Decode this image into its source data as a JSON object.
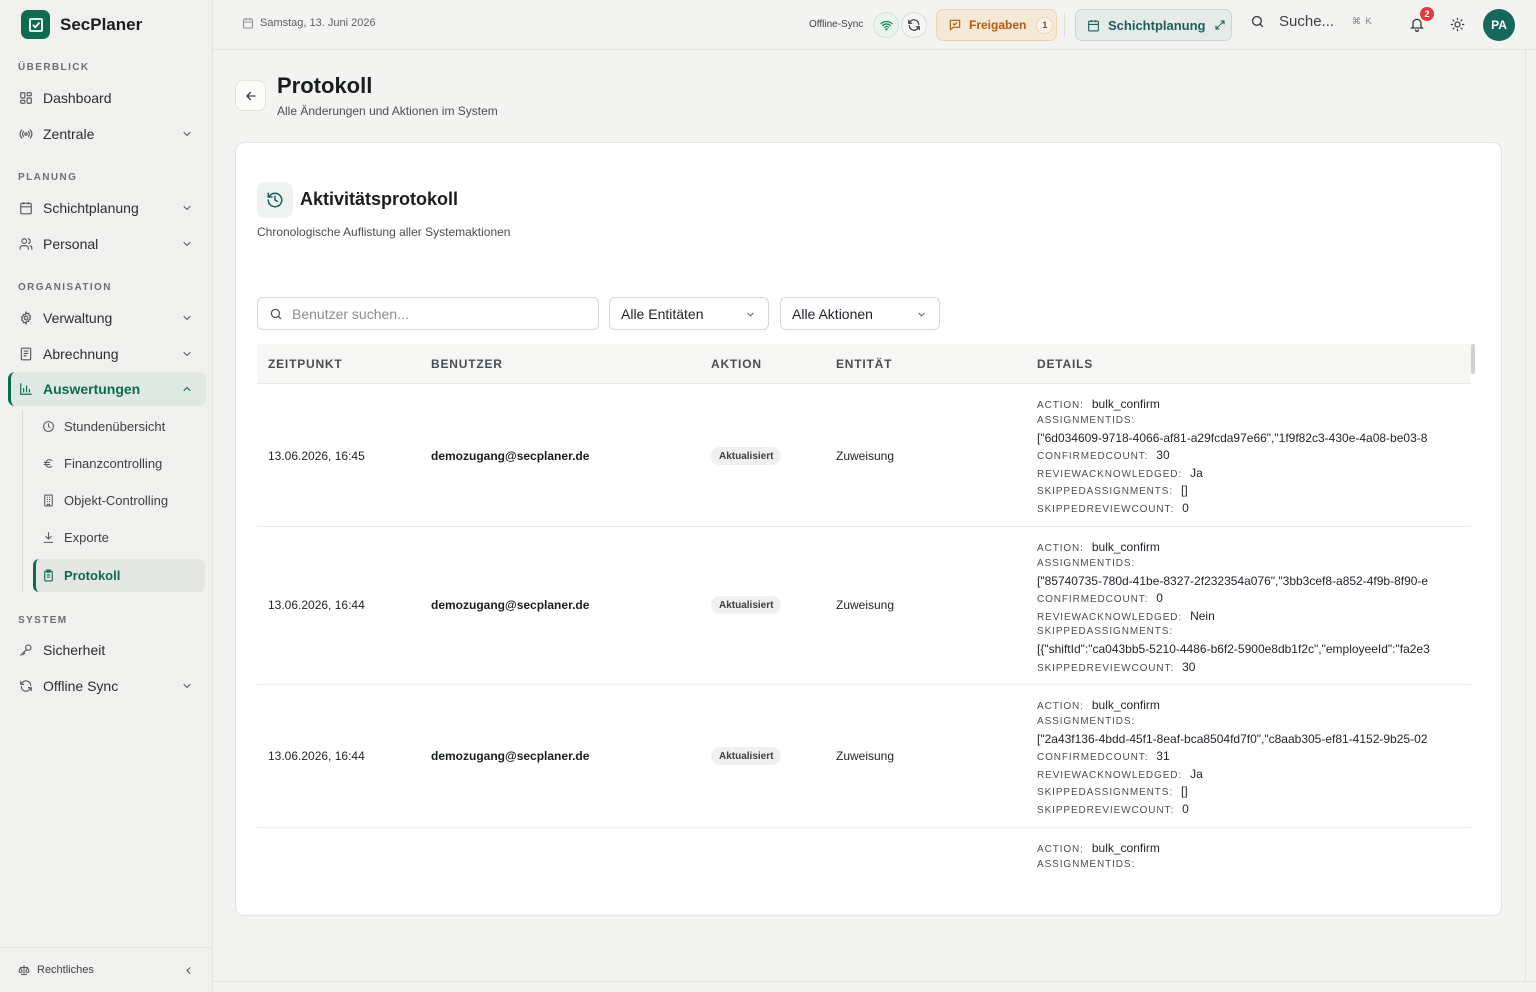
{
  "app": {
    "name": "SecPlaner"
  },
  "sidebar": {
    "sections": {
      "overview": "ÜBERBLICK",
      "planning": "PLANUNG",
      "organisation": "ORGANISATION",
      "system": "SYSTEM"
    },
    "items": {
      "dashboard": "Dashboard",
      "zentrale": "Zentrale",
      "schichtplanung": "Schichtplanung",
      "personal": "Personal",
      "verwaltung": "Verwaltung",
      "abrechnung": "Abrechnung",
      "auswertungen": "Auswertungen",
      "sicherheit": "Sicherheit",
      "offline_sync": "Offline Sync"
    },
    "sub_items": {
      "stundenuebersicht": "Stundenübersicht",
      "finanzcontrolling": "Finanzcontrolling",
      "objekt_controlling": "Objekt-Controlling",
      "exporte": "Exporte",
      "protokoll": "Protokoll"
    },
    "footer": "Rechtliches"
  },
  "topbar": {
    "date": "Samstag, 13. Juni 2026",
    "offline_sync_label": "Offline-Sync",
    "freigaben_label": "Freigaben",
    "freigaben_count": "1",
    "schichtplanung_label": "Schichtplanung",
    "search_label": "Suche...",
    "search_shortcut": "⌘ K",
    "notification_count": "2",
    "avatar_initials": "PA"
  },
  "page": {
    "title": "Protokoll",
    "subtitle": "Alle Änderungen und Aktionen im System"
  },
  "card": {
    "title": "Aktivitätsprotokoll",
    "subtitle": "Chronologische Auflistung aller Systemaktionen"
  },
  "filters": {
    "search_placeholder": "Benutzer suchen...",
    "entity_select": "Alle Entitäten",
    "action_select": "Alle Aktionen"
  },
  "table": {
    "headers": {
      "time": "ZEITPUNKT",
      "user": "BENUTZER",
      "action": "AKTION",
      "entity": "ENTITÄT",
      "details": "DETAILS"
    },
    "rows": [
      {
        "time": "13.06.2026, 16:45",
        "user": "demozugang@secplaner.de",
        "action": "Aktualisiert",
        "entity": "Zuweisung",
        "details": {
          "action_key": "ACTION:",
          "action_val": "bulk_confirm",
          "assign_key": "ASSIGNMENTIDS:",
          "assign_val": "[\"6d034609-9718-4066-af81-a29fcda97e66\",\"1f9f82c3-430e-4a08-be03-8",
          "confirmed_key": "CONFIRMEDCOUNT:",
          "confirmed_val": "30",
          "review_key": "REVIEWACKNOWLEDGED:",
          "review_val": "Ja",
          "skipped_key": "SKIPPEDASSIGNMENTS:",
          "skipped_val": "[]",
          "skippedrev_key": "SKIPPEDREVIEWCOUNT:",
          "skippedrev_val": "0"
        }
      },
      {
        "time": "13.06.2026, 16:44",
        "user": "demozugang@secplaner.de",
        "action": "Aktualisiert",
        "entity": "Zuweisung",
        "details": {
          "action_key": "ACTION:",
          "action_val": "bulk_confirm",
          "assign_key": "ASSIGNMENTIDS:",
          "assign_val": "[\"85740735-780d-41be-8327-2f232354a076\",\"3bb3cef8-a852-4f9b-8f90-e",
          "confirmed_key": "CONFIRMEDCOUNT:",
          "confirmed_val": "0",
          "review_key": "REVIEWACKNOWLEDGED:",
          "review_val": "Nein",
          "skipped_key": "SKIPPEDASSIGNMENTS:",
          "skipped_val": "[{\"shiftId\":\"ca043bb5-5210-4486-b6f2-5900e8db1f2c\",\"employeeId\":\"fa2e3",
          "skippedrev_key": "SKIPPEDREVIEWCOUNT:",
          "skippedrev_val": "30"
        }
      },
      {
        "time": "13.06.2026, 16:44",
        "user": "demozugang@secplaner.de",
        "action": "Aktualisiert",
        "entity": "Zuweisung",
        "details": {
          "action_key": "ACTION:",
          "action_val": "bulk_confirm",
          "assign_key": "ASSIGNMENTIDS:",
          "assign_val": "[\"2a43f136-4bdd-45f1-8eaf-bca8504fd7f0\",\"c8aab305-ef81-4152-9b25-02",
          "confirmed_key": "CONFIRMEDCOUNT:",
          "confirmed_val": "31",
          "review_key": "REVIEWACKNOWLEDGED:",
          "review_val": "Ja",
          "skipped_key": "SKIPPEDASSIGNMENTS:",
          "skipped_val": "[]",
          "skippedrev_key": "SKIPPEDREVIEWCOUNT:",
          "skippedrev_val": "0"
        }
      },
      {
        "details": {
          "action_key": "ACTION:",
          "action_val": "bulk_confirm",
          "assign_key": "ASSIGNMENTIDS:"
        }
      }
    ]
  },
  "colors": {
    "brand": "#0f6b4f",
    "freigaben": "#b35a10",
    "notification": "#e23b3b",
    "avatar": "#14695b"
  }
}
